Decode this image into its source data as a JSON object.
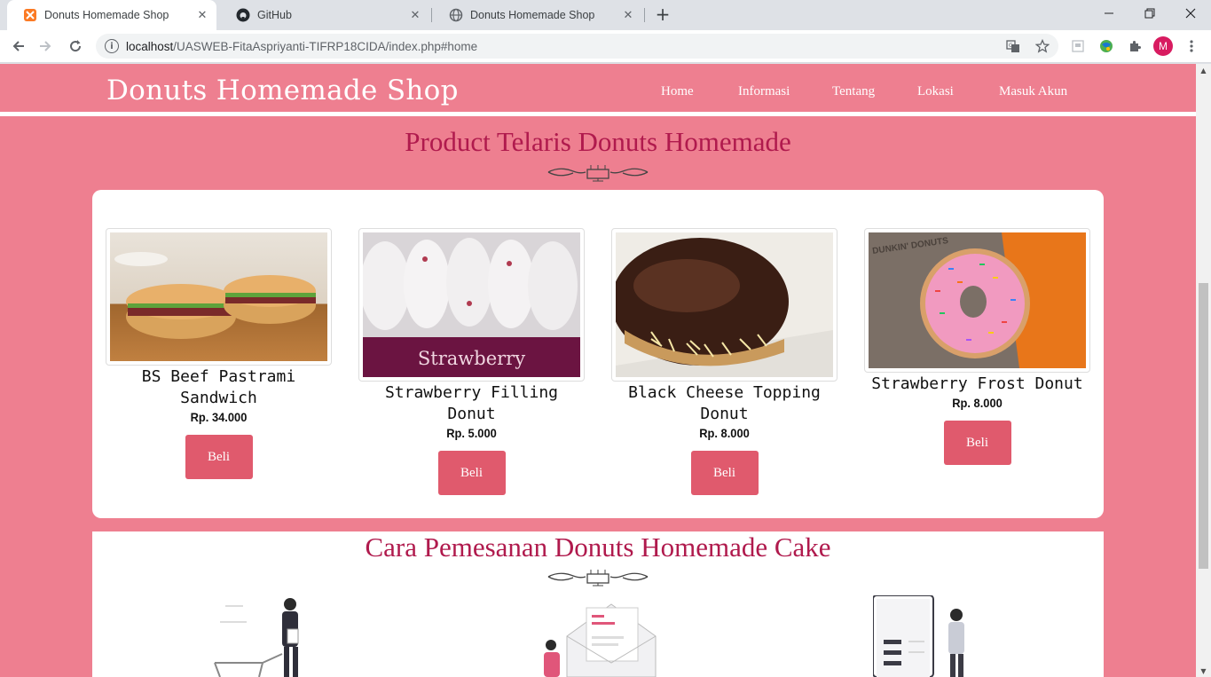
{
  "browser": {
    "tabs": [
      {
        "title": "Donuts Homemade Shop",
        "active": true,
        "favicon": "xampp-icon"
      },
      {
        "title": "GitHub",
        "active": false,
        "favicon": "github-icon"
      },
      {
        "title": "Donuts Homemade Shop",
        "active": false,
        "favicon": "globe-icon"
      }
    ],
    "url_host": "localhost",
    "url_path": "/UASWEB-FitaAspriyanti-TIFRP18CIDA/index.php#home",
    "profile_initial": "M"
  },
  "site": {
    "brand": "Donuts Homemade Shop",
    "menu": [
      "Home",
      "Informasi",
      "Tentang",
      "Lokasi",
      "Masuk Akun"
    ]
  },
  "products_section": {
    "title": "Product Telaris Donuts Homemade",
    "items": [
      {
        "name": "BS Beef Pastrami Sandwich",
        "price": "Rp. 34.000",
        "button": "Beli"
      },
      {
        "name": "Strawberry Filling Donut",
        "price": "Rp. 5.000",
        "button": "Beli",
        "image_caption": "Strawberry"
      },
      {
        "name": "Black Cheese Topping Donut",
        "price": "Rp. 8.000",
        "button": "Beli"
      },
      {
        "name": "Strawberry Frost Donut",
        "price": "Rp. 8.000",
        "button": "Beli",
        "image_caption": "DUNKIN' DONUTS"
      }
    ]
  },
  "order_section": {
    "title": "Cara Pemesanan Donuts Homemade Cake"
  },
  "colors": {
    "page_bg": "#ee7f90",
    "title_color": "#b01a4d",
    "button_bg": "#e05a6d"
  }
}
